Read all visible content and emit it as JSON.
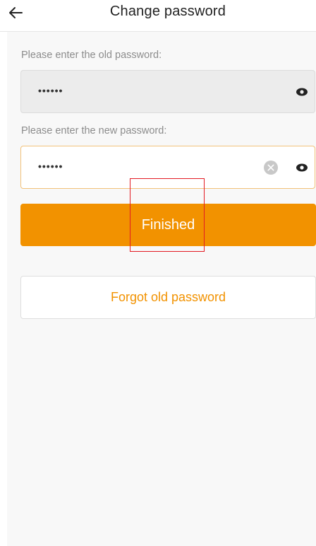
{
  "header": {
    "title": "Change password",
    "back_icon": "arrow-left-icon"
  },
  "form": {
    "old_password": {
      "label": "Please enter the old password:",
      "value": "••••••",
      "toggle_icon": "eye-icon"
    },
    "new_password": {
      "label": "Please enter the new password:",
      "value": "••••••",
      "clear_icon": "clear-icon",
      "toggle_icon": "eye-icon"
    }
  },
  "actions": {
    "submit_label": "Finished",
    "forgot_label": "Forgot old password"
  },
  "colors": {
    "accent": "#f29200",
    "highlight": "#e31b23",
    "background": "#f8f8f8"
  }
}
